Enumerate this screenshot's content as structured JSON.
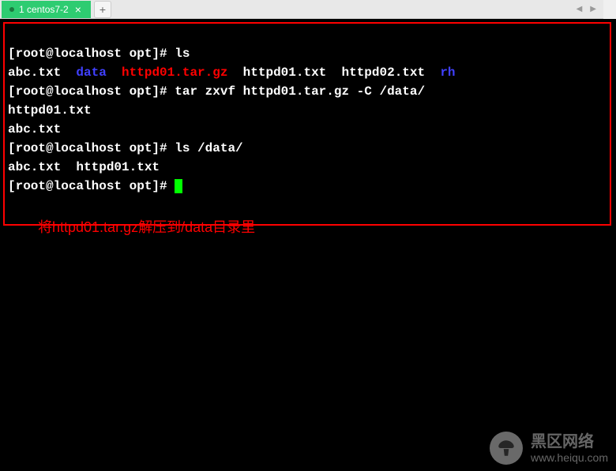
{
  "tab": {
    "label": "1 centos7-2",
    "close": "×",
    "add": "+"
  },
  "nav": {
    "left": "◀",
    "right": "▶",
    "menu": "≡"
  },
  "terminal": {
    "line1_prompt": "[root@localhost opt]# ",
    "line1_cmd": "ls",
    "line2_f1": "abc.txt",
    "line2_gap1": "  ",
    "line2_data": "data",
    "line2_gap2": "  ",
    "line2_tgz": "httpd01.tar.gz",
    "line2_gap3": "  ",
    "line2_f2": "httpd01.txt",
    "line2_gap4": "  ",
    "line2_f3": "httpd02.txt",
    "line2_gap5": "  ",
    "line2_rh": "rh",
    "line3_prompt": "[root@localhost opt]# ",
    "line3_cmd": "tar zxvf httpd01.tar.gz -C /data/",
    "line4": "httpd01.txt",
    "line5": "abc.txt",
    "line6_prompt": "[root@localhost opt]# ",
    "line6_cmd": "ls /data/",
    "line7": "abc.txt  httpd01.txt",
    "line8_prompt": "[root@localhost opt]# "
  },
  "annotation": "将httpd01.tar.gz解压到/data目录里",
  "watermark": {
    "cn": "黑区网络",
    "url": "www.heiqu.com"
  }
}
